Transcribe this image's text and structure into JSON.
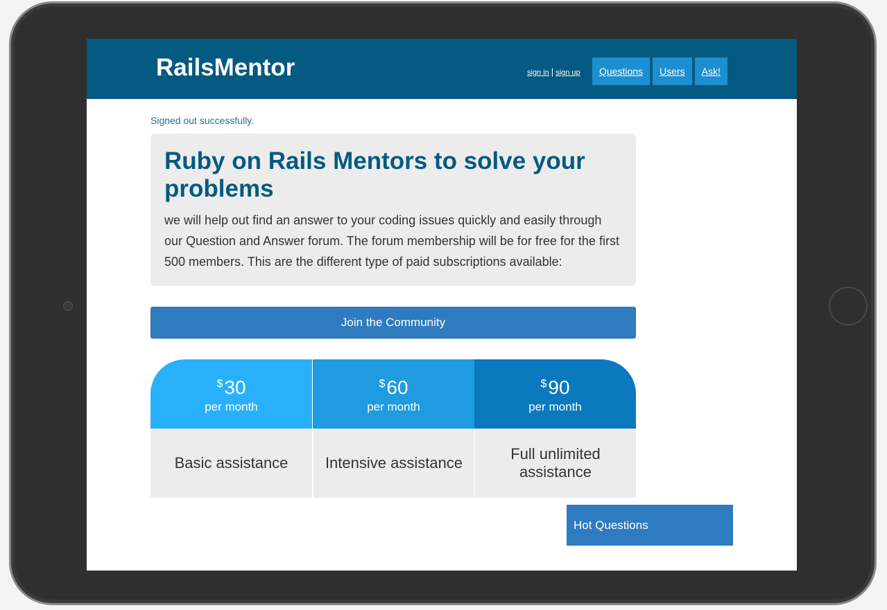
{
  "navbar": {
    "brand": "RailsMentor",
    "sign_in": "sign in",
    "separator": "|",
    "sign_up": "sign up",
    "links": [
      "Questions",
      "Users",
      "Ask!"
    ]
  },
  "notice": "Signed out successfully.",
  "hero": {
    "title": "Ruby on Rails Mentors to solve your problems",
    "body": "we will help out find an answer to your coding issues quickly and easily through our Question and Answer forum. The forum membership will be for free for the first 500 members. This are the different type of paid subscriptions available:"
  },
  "join_label": "Join the Community",
  "plans": [
    {
      "currency": "$",
      "amount": "30",
      "period": "per month",
      "description": "Basic assistance"
    },
    {
      "currency": "$",
      "amount": "60",
      "period": "per month",
      "description": "Intensive assistance"
    },
    {
      "currency": "$",
      "amount": "90",
      "period": "per month",
      "description": "Full unlimited assistance"
    }
  ],
  "sidebar": {
    "hot_questions": "Hot Questions"
  },
  "colors": {
    "navbar": "#045a80",
    "accent": "#2f7bbf",
    "plan1": "#29b0fb",
    "plan2": "#1f9bdf",
    "plan3": "#0b79bd"
  }
}
